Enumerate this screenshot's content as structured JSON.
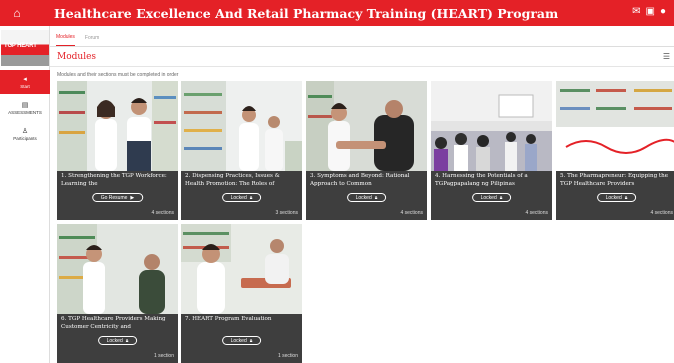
{
  "header": {
    "home_icon": "home-icon",
    "title": "Healthcare Excellence And Retail Pharmacy Training (HEART) Program",
    "right_icons": [
      "mail-icon",
      "notification-icon",
      "user-icon"
    ]
  },
  "sidebar": {
    "logo_text": "TGP HEART",
    "items": [
      {
        "label": "Start",
        "icon": "start-icon"
      },
      {
        "label": "ASSESSMENTS",
        "icon": "assessment-icon"
      },
      {
        "label": "Participants",
        "icon": "participants-icon"
      }
    ]
  },
  "tabs": [
    {
      "label": "Modules"
    },
    {
      "label": "Forum"
    }
  ],
  "modules": {
    "heading": "Modules",
    "subtitle": "Modules and their sections must be completed in order",
    "menu_icon": "menu-icon",
    "cards": [
      {
        "title": "1. Strengthening the TGP Workforce: Learning the",
        "button": "Go Resume",
        "button_icon": "play-icon",
        "sections": "4 sections"
      },
      {
        "title": "2. Dispensing Practices, Issues & Health Promotion: The Roles of",
        "button": "Locked",
        "button_icon": "lock-icon",
        "sections": "3 sections"
      },
      {
        "title": "3. Symptoms and Beyond: Rational Approach to Common",
        "button": "Locked",
        "button_icon": "lock-icon",
        "sections": "4 sections"
      },
      {
        "title": "4. Harnessing the Potentials of a TGPagpapalang ng Pilipinas",
        "button": "Locked",
        "button_icon": "lock-icon",
        "sections": "4 sections"
      },
      {
        "title": "5. The Pharmapreneur: Equipping the TGP Healthcare Providers",
        "button": "Locked",
        "button_icon": "lock-icon",
        "sections": "4 sections"
      },
      {
        "title": "6. TGP Healthcare Providers Making Customer Centricity and",
        "button": "Locked",
        "button_icon": "lock-icon",
        "sections": "1 section"
      },
      {
        "title": "7. HEART Program Evaluation",
        "button": "Locked",
        "button_icon": "lock-icon",
        "sections": "1 section"
      }
    ]
  }
}
